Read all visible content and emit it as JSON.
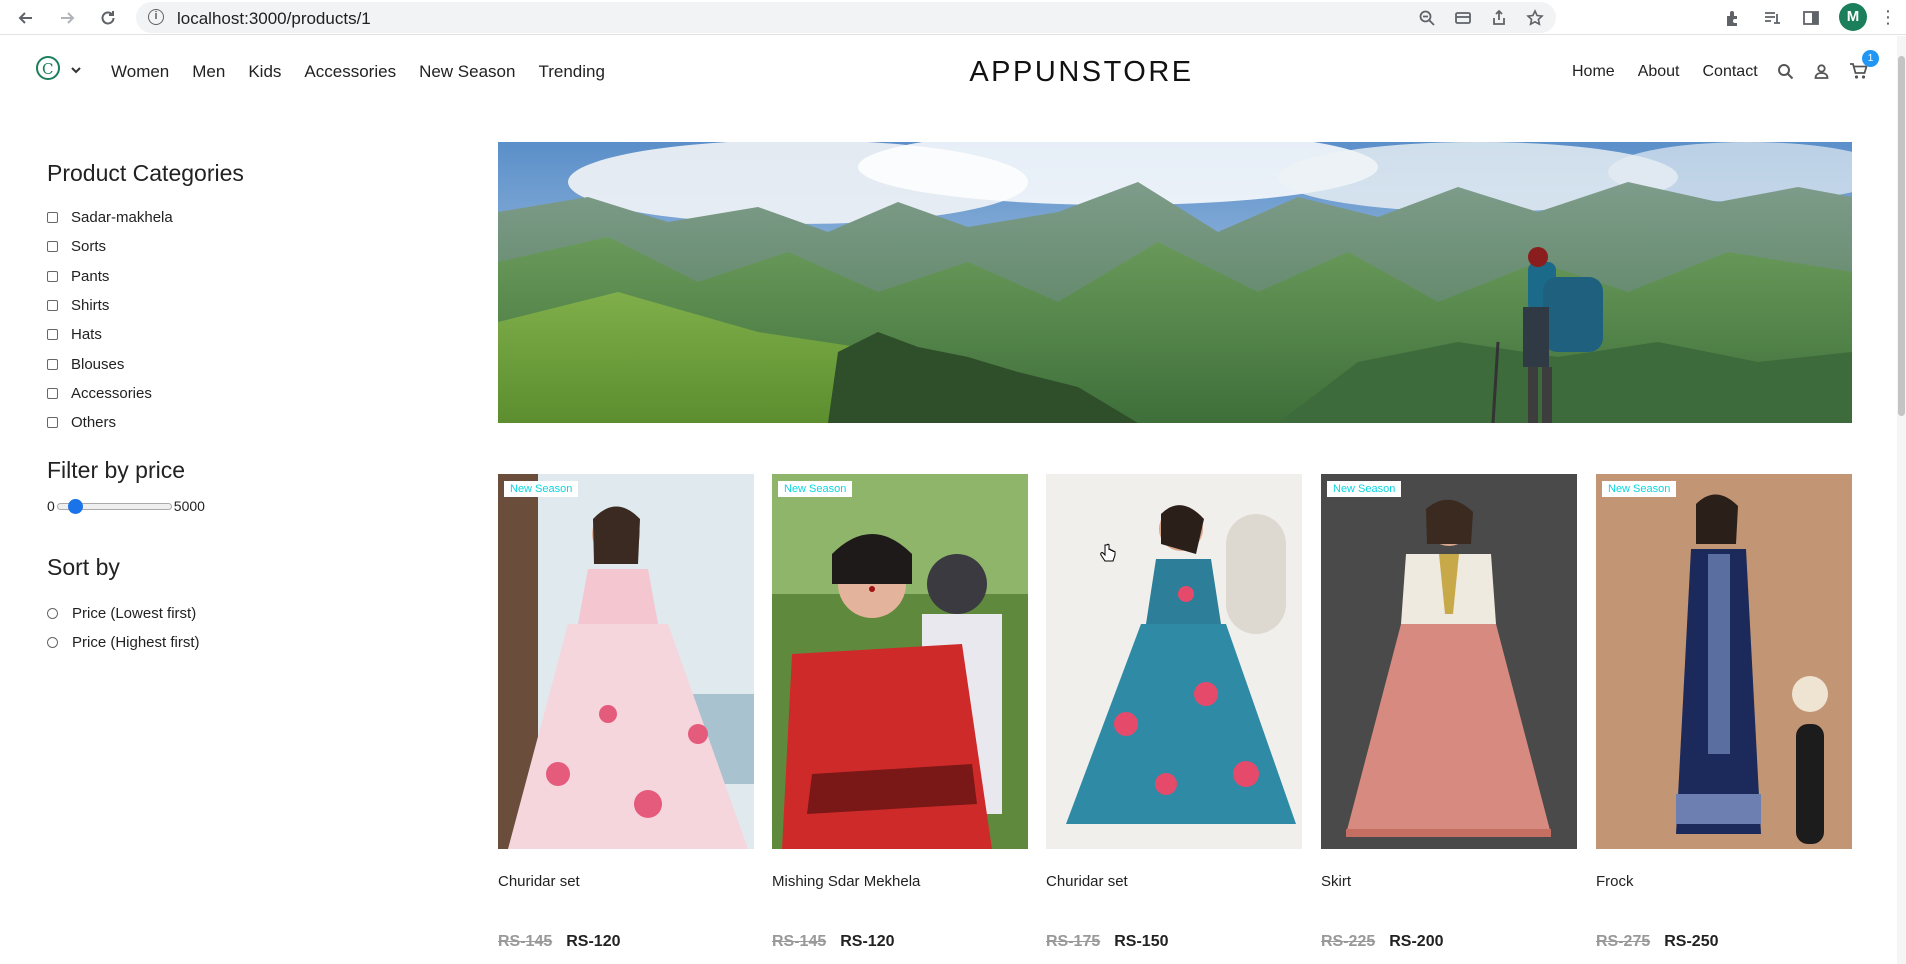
{
  "browser": {
    "url": "localhost:3000/products/1",
    "profile_initial": "M",
    "icons": [
      "back-icon",
      "forward-icon",
      "reload-icon",
      "info-icon",
      "zoom-icon",
      "card-icon",
      "share-icon",
      "star-icon",
      "extensions-icon",
      "reading-list-icon",
      "side-panel-icon",
      "more-icon"
    ]
  },
  "header": {
    "logo_text": "C",
    "logo_caret": "⌄",
    "brand": "APPUNSTORE",
    "left_nav": [
      "Women",
      "Men",
      "Kids",
      "Accessories",
      "New Season",
      "Trending"
    ],
    "right_nav": [
      "Home",
      "About",
      "Contact"
    ],
    "cart_count": "1",
    "icons": [
      "search-icon",
      "user-icon",
      "cart-icon"
    ]
  },
  "sidebar": {
    "categories_title": "Product Categories",
    "categories": [
      "Sadar-makhela",
      "Sorts",
      "Pants",
      "Shirts",
      "Hats",
      "Blouses",
      "Accessories",
      "Others"
    ],
    "price_title": "Filter by price",
    "price_min": "0",
    "price_max": "5000",
    "price_value_fraction": 0.0,
    "sort_title": "Sort by",
    "sort_options": [
      "Price (Lowest first)",
      "Price (Highest first)"
    ]
  },
  "products": [
    {
      "name": "Churidar set",
      "old_price": "RS-145",
      "new_price": "RS-120",
      "badge": "New Season"
    },
    {
      "name": "Mishing Sdar Mekhela",
      "old_price": "RS-145",
      "new_price": "RS-120",
      "badge": "New Season"
    },
    {
      "name": "Churidar set",
      "old_price": "RS-175",
      "new_price": "RS-150",
      "badge": ""
    },
    {
      "name": "Skirt",
      "old_price": "RS-225",
      "new_price": "RS-200",
      "badge": "New Season"
    },
    {
      "name": "Frock",
      "old_price": "RS-275",
      "new_price": "RS-250",
      "badge": "New Season"
    }
  ],
  "colors": {
    "accent": "#1a73e8",
    "badge_text": "#0bd6e0",
    "logo": "#1a7f5a",
    "cart_badge": "#2196f3"
  }
}
